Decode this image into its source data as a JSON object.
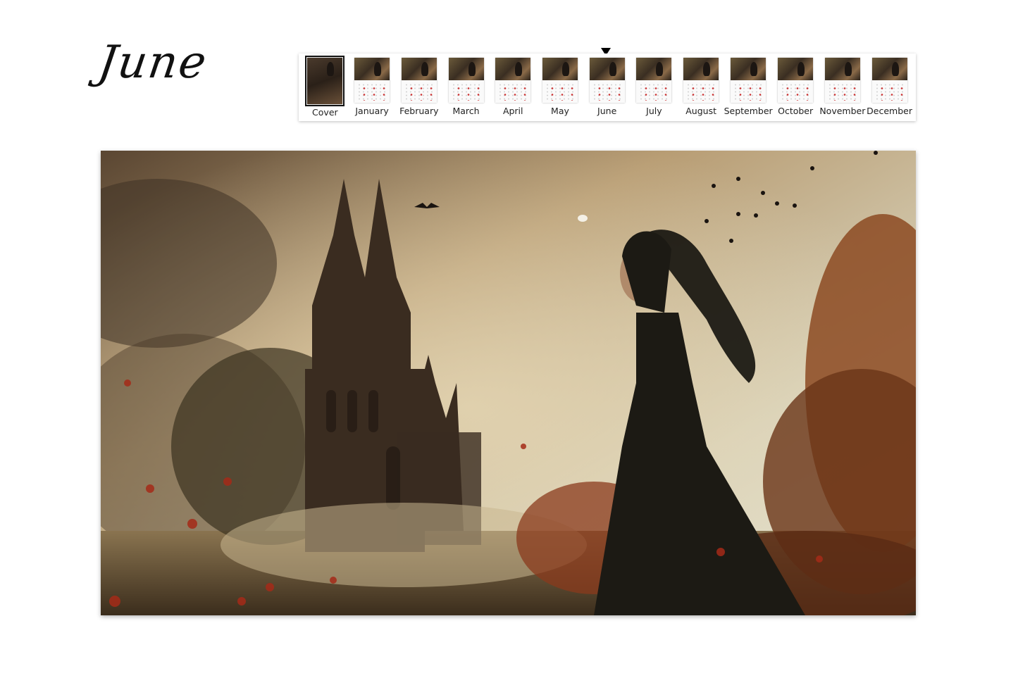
{
  "title": "June",
  "months": [
    "Cover",
    "January",
    "February",
    "March",
    "April",
    "May",
    "June",
    "July",
    "August",
    "September",
    "October",
    "November",
    "December"
  ],
  "selected": "June"
}
